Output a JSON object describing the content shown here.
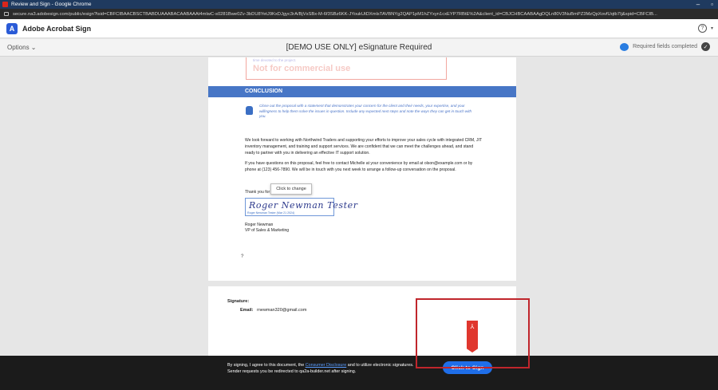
{
  "browser": {
    "window_title": "Review and Sign - Google Chrome",
    "url": "secure.na3.adobesign.com/public/esign?tsid=CBFCIBAACBSCTBABDUAAABACAABAAAt4mlwC-s0281Bwe0Zv-3bDU8YetJ9KxDJgyc3rA/BjVsSBx-M-6f3SBz6KK-JYoukUtDXmlsTAVBNYg2QAP1pM1hZYxyn1cxEYP7RBtE%2A&client_id=CBJCHBCAABAAgDQLn80V3NuBmPZ3MzQpXovfUqtb7Ij&spid=CBFCIB..."
  },
  "app": {
    "name": "Adobe Acrobat Sign",
    "help_icon": "question-circle-icon"
  },
  "toolbar": {
    "options_label": "Options",
    "document_title": "[DEMO USE ONLY] eSignature Required",
    "status_label": "Required fields completed"
  },
  "document": {
    "prev_section_small_text": "time devoted to the project.",
    "prev_section_watermark": "Not for commercial use",
    "banner_title": "CONCLUSION",
    "tip_text": "Close out the proposal with a statement that demonstrates your concern for the client and their needs, your expertise, and your willingness to help them solve the issues in question. Include any expected next steps and note the ways they can get in touch with you.",
    "paragraph1": "We look forward to working with Northwind Traders and supporting your efforts to improve your sales cycle with integrated CRM, JIT inventory management, and training and support services. We are confident that we can meet the challenges ahead, and stand ready to partner with you in delivering an effective IT support solution.",
    "paragraph2": "If you have questions on this proposal, feel free to contact Michelle at your convenience by email at olson@example.com or by phone at (123) 456-7890. We will be in touch with you next week to arrange a follow-up conversation on the proposal.",
    "thank_you": "Thank you for your consideration,",
    "tooltip": "Click to change",
    "signature_script": "Roger Newman Tester",
    "signature_caption": "Roger Newman Tester    (Mar 21 2024)",
    "signer_name": "Roger Newman",
    "signer_title": "VP of Sales & Marketing",
    "marker": "?",
    "signature_block_label": "Signature:",
    "email_label": "Email:",
    "email_value": "rnewman320@gmail.com"
  },
  "footer": {
    "consent_prefix": "By signing, I agree to this document, the ",
    "consent_link": "Consumer Disclosure",
    "consent_suffix": " and to utilize electronic signatures.",
    "redirect_note": "Sender requests you be redirected to qa2a-builder.net after signing.",
    "sign_button": "Click to Sign"
  },
  "colors": {
    "accent": "#1f6ee8",
    "banner": "#4776c6",
    "highlight": "#c0262c",
    "adobe_red": "#e0372e"
  }
}
